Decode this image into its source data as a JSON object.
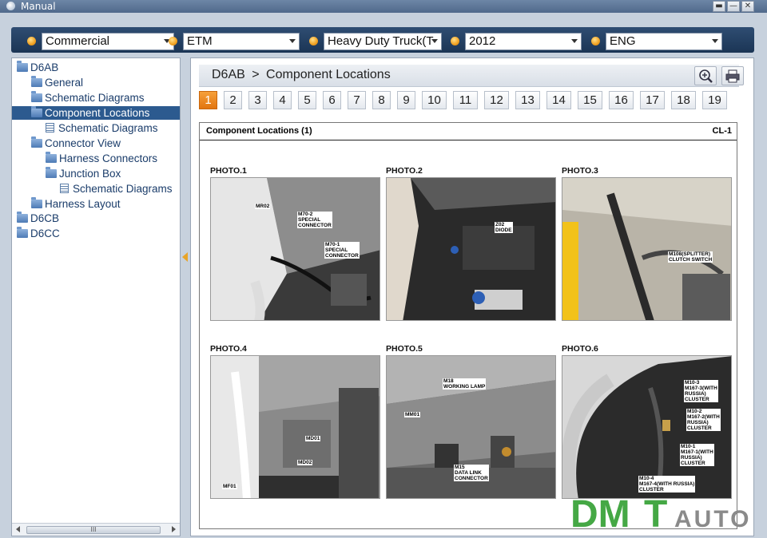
{
  "window": {
    "title": "Manual",
    "controls": [
      "minimize",
      "maximize",
      "close"
    ]
  },
  "filters": [
    {
      "value": "Commercial"
    },
    {
      "value": "ETM"
    },
    {
      "value": "Heavy Duty Truck(T"
    },
    {
      "value": "2012"
    },
    {
      "value": "ENG"
    }
  ],
  "tree": [
    {
      "label": "D6AB",
      "icon": "folder-open-icon",
      "level": 0
    },
    {
      "label": "General",
      "icon": "folder-icon",
      "level": 1
    },
    {
      "label": "Schematic Diagrams",
      "icon": "folder-icon",
      "level": 1
    },
    {
      "label": "Component Locations",
      "icon": "folder-open-icon",
      "level": 1,
      "selected": true
    },
    {
      "label": "Schematic Diagrams",
      "icon": "document-icon",
      "level": 2
    },
    {
      "label": "Connector View",
      "icon": "folder-open-icon",
      "level": 1
    },
    {
      "label": "Harness Connectors",
      "icon": "folder-icon",
      "level": 2
    },
    {
      "label": "Junction Box",
      "icon": "folder-open-icon",
      "level": 2
    },
    {
      "label": "Schematic Diagrams",
      "icon": "document-icon",
      "level": 3
    },
    {
      "label": "Harness Layout",
      "icon": "folder-icon",
      "level": 1
    },
    {
      "label": "D6CB",
      "icon": "folder-icon",
      "level": 0
    },
    {
      "label": "D6CC",
      "icon": "folder-icon",
      "level": 0
    }
  ],
  "scroll_label": "III",
  "breadcrumb": {
    "root": "D6AB",
    "separator": ">",
    "current": "Component Locations"
  },
  "tools": [
    "zoom-in-icon",
    "print-icon"
  ],
  "pages": [
    "1",
    "2",
    "3",
    "4",
    "5",
    "6",
    "7",
    "8",
    "9",
    "10",
    "11",
    "12",
    "13",
    "14",
    "15",
    "16",
    "17",
    "18",
    "19"
  ],
  "active_page": "1",
  "sheet": {
    "title": "Component Locations (1)",
    "code": "CL-1",
    "photos": [
      {
        "label": "PHOTO.1",
        "callouts": [
          "MR02",
          "M70-2\nSPECIAL\nCONNECTOR",
          "M70-1\nSPECIAL\nCONNECTOR"
        ]
      },
      {
        "label": "PHOTO.2",
        "callouts": [
          "Z02\nDIODE"
        ]
      },
      {
        "label": "PHOTO.3",
        "callouts": [
          "M108(SPLITTER)\nCLUTCH SWITCH"
        ]
      },
      {
        "label": "PHOTO.4",
        "callouts": [
          "MD01",
          "MD02",
          "MF01"
        ]
      },
      {
        "label": "PHOTO.5",
        "callouts": [
          "M18\nWORKING LAMP",
          "MM01",
          "M15\nDATA LINK\nCONNECTOR"
        ]
      },
      {
        "label": "PHOTO.6",
        "callouts": [
          "M10-3\nM167-3(WITH\nRUSSIA)\nCLUSTER",
          "M10-2\nM167-2(WITH\nRUSSIA)\nCLUSTER",
          "M10-1\nM167-1(WITH\nRUSSIA)\nCLUSTER",
          "M10-4\nM167-4(WITH RUSSIA)\nCLUSTER"
        ]
      }
    ]
  },
  "watermark": {
    "text": "DMTAUTO",
    "colors": {
      "green": "#45a845",
      "gray": "#8a8a8a"
    }
  },
  "colors": {
    "accent": "#e27510",
    "frame": "#c7d1dd",
    "topbar": "#1b3555",
    "selection": "#2c5a8f"
  }
}
